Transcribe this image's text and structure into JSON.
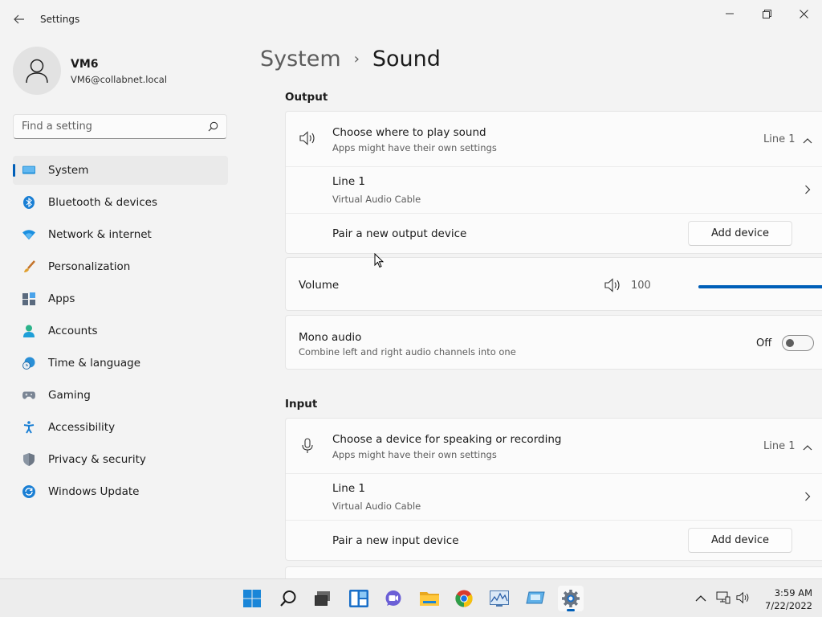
{
  "window": {
    "title": "Settings",
    "controls": {
      "minimize": "minimize-icon",
      "maximize": "restore-icon",
      "close": "close-icon"
    }
  },
  "user": {
    "name": "VM6",
    "email": "VM6@collabnet.local"
  },
  "search": {
    "placeholder": "Find a setting"
  },
  "sidebar": {
    "items": [
      {
        "label": "System",
        "icon": "system-icon",
        "active": true
      },
      {
        "label": "Bluetooth & devices",
        "icon": "bluetooth-icon"
      },
      {
        "label": "Network & internet",
        "icon": "wifi-icon"
      },
      {
        "label": "Personalization",
        "icon": "brush-icon"
      },
      {
        "label": "Apps",
        "icon": "apps-icon"
      },
      {
        "label": "Accounts",
        "icon": "accounts-icon"
      },
      {
        "label": "Time & language",
        "icon": "clock-globe-icon"
      },
      {
        "label": "Gaming",
        "icon": "gamepad-icon"
      },
      {
        "label": "Accessibility",
        "icon": "accessibility-icon"
      },
      {
        "label": "Privacy & security",
        "icon": "shield-icon"
      },
      {
        "label": "Windows Update",
        "icon": "update-icon"
      }
    ]
  },
  "breadcrumb": {
    "parent": "System",
    "separator": "›",
    "current": "Sound"
  },
  "output": {
    "section_title": "Output",
    "choose": {
      "title": "Choose where to play sound",
      "subtitle": "Apps might have their own settings",
      "value": "Line 1"
    },
    "device": {
      "name": "Line 1",
      "subtitle": "Virtual Audio Cable"
    },
    "pair": {
      "label": "Pair a new output device",
      "button": "Add device"
    },
    "volume": {
      "label": "Volume",
      "value": "100",
      "percent": 100
    },
    "mono": {
      "title": "Mono audio",
      "subtitle": "Combine left and right audio channels into one",
      "state": "Off"
    }
  },
  "input": {
    "section_title": "Input",
    "choose": {
      "title": "Choose a device for speaking or recording",
      "subtitle": "Apps might have their own settings",
      "value": "Line 1"
    },
    "device": {
      "name": "Line 1",
      "subtitle": "Virtual Audio Cable"
    },
    "pair": {
      "label": "Pair a new input device",
      "button": "Add device"
    }
  },
  "taskbar": {
    "apps": [
      "start-icon",
      "search-icon",
      "task-view-icon",
      "widgets-icon",
      "chat-icon",
      "file-explorer-icon",
      "chrome-icon",
      "performance-monitor-icon",
      "virtual-cable-icon",
      "settings-icon"
    ],
    "clock": {
      "time": "3:59 AM",
      "date": "7/22/2022"
    }
  },
  "colors": {
    "accent": "#005fb8",
    "background": "#f3f3f3",
    "card": "#fbfbfb"
  }
}
